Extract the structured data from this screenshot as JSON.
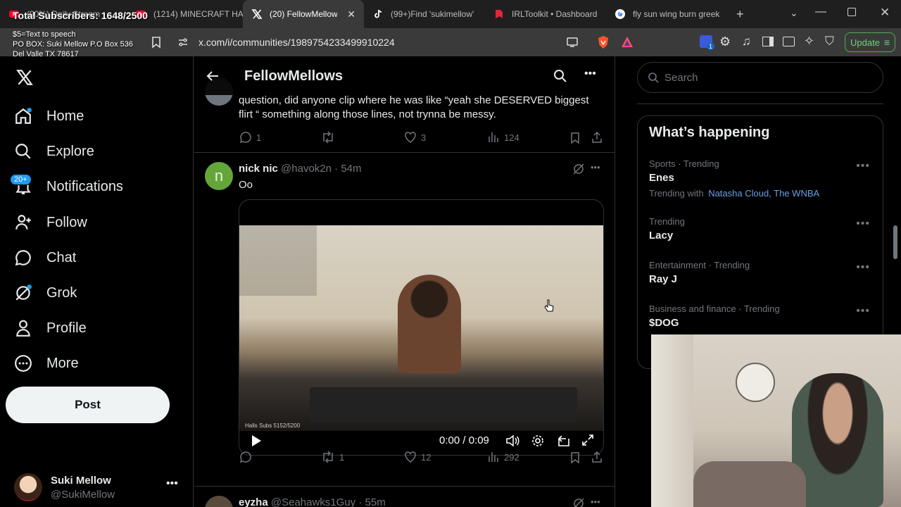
{
  "overlay": {
    "subscribers": "Total Subscribers: 1648/2500",
    "tts": "$5=Text to speech",
    "po_line1": "PO BOX: Suki Mellow P.O Box 536",
    "po_line2": "Del Valle TX 78617"
  },
  "tabs": [
    {
      "label": "(90%) Daily Stream",
      "icon": "youtube-icon"
    },
    {
      "label": "(1214) MINECRAFT HA",
      "icon": "youtube-icon"
    },
    {
      "label": "(20) FellowMellows",
      "icon": "x-icon",
      "active": true
    },
    {
      "label": "(99+)Find 'sukimellow'",
      "icon": "tiktok-icon"
    },
    {
      "label": "IRLToolkit • Dashboard",
      "icon": "irltoolkit-icon"
    },
    {
      "label": "fly sun wing burn greek",
      "icon": "google-icon"
    }
  ],
  "browser": {
    "url": "x.com/i/communities/1989754233499910224",
    "update_label": "Update",
    "extension_badge": "1"
  },
  "nav": {
    "items": [
      {
        "label": "Home",
        "icon": "home-icon"
      },
      {
        "label": "Explore",
        "icon": "search-icon"
      },
      {
        "label": "Notifications",
        "icon": "bell-icon"
      },
      {
        "label": "Follow",
        "icon": "follow-icon"
      },
      {
        "label": "Chat",
        "icon": "chat-icon"
      },
      {
        "label": "Grok",
        "icon": "grok-icon"
      },
      {
        "label": "Profile",
        "icon": "profile-icon"
      },
      {
        "label": "More",
        "icon": "more-icon"
      }
    ],
    "notif_badge": "20+",
    "post_label": "Post",
    "account_name": "Suki Mellow",
    "account_handle": "@SukiMellow"
  },
  "header": {
    "title": "FellowMellows"
  },
  "tweet1": {
    "text": "question, did anyone clip where he was like “yeah she DESERVED biggest flirt “ something along those lines, not trynna be messy.",
    "replies": "1",
    "likes": "3",
    "views": "124"
  },
  "tweet2": {
    "avatar_letter": "n",
    "name": "nick nic",
    "handle": "@havok2n",
    "time": "· 54m",
    "text": "Oo",
    "video_time": "0:00 / 0:09",
    "retweets": "1",
    "likes": "12",
    "views": "292",
    "video_overlay_subs": "Halls Subs 5152/5200"
  },
  "tweet3": {
    "name": "eyzha",
    "handle": "@Seahawks1Guy",
    "time": "· 55m"
  },
  "search": {
    "placeholder": "Search"
  },
  "happening": {
    "title": "What’s happening",
    "trends": [
      {
        "meta": "Sports · Trending",
        "name": "Enes",
        "with_prefix": "Trending with",
        "with_links": "Natasha Cloud, The WNBA"
      },
      {
        "meta": "Trending",
        "name": "Lacy"
      },
      {
        "meta": "Entertainment · Trending",
        "name": "Ray J"
      },
      {
        "meta": "Business and finance · Trending",
        "name": "$DOG"
      }
    ]
  },
  "colors": {
    "accent": "#1d9bf0",
    "link": "#6b9fe8",
    "update_green": "#4caf50"
  }
}
